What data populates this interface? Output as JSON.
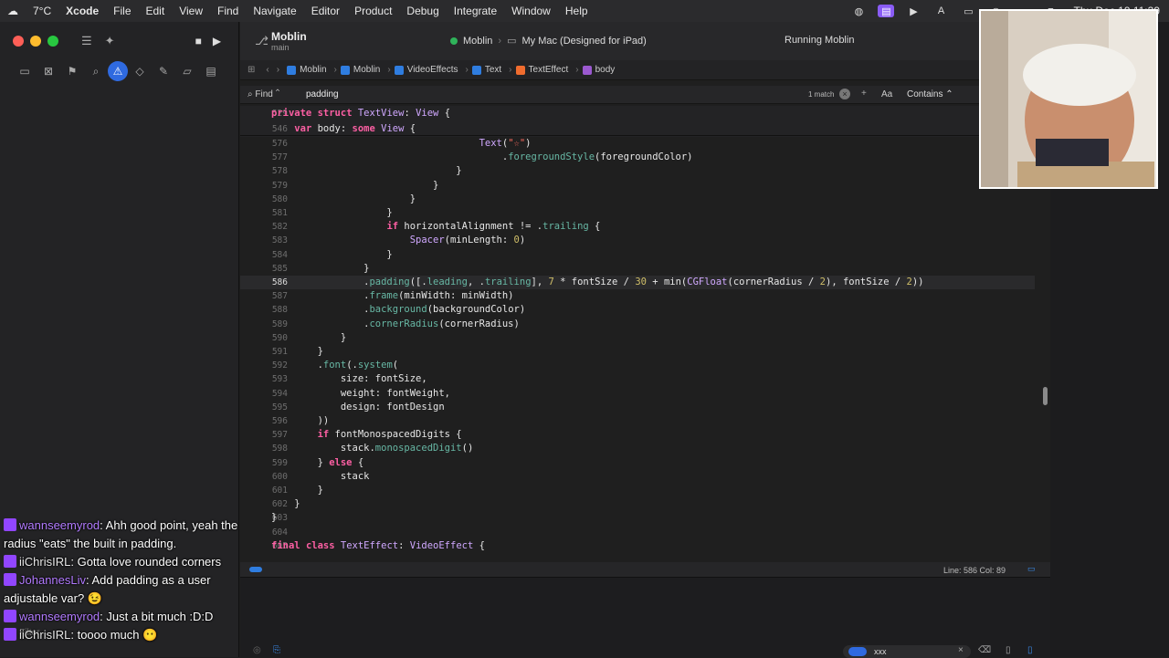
{
  "menubar": {
    "app": "Xcode",
    "items": [
      "File",
      "Edit",
      "View",
      "Find",
      "Navigate",
      "Editor",
      "Product",
      "Debug",
      "Integrate",
      "Window",
      "Help"
    ],
    "clock": "Thu Dec 19 11:39",
    "weather": "7°C"
  },
  "toolbar": {
    "project": "Moblin",
    "branch": "main",
    "scheme": "Moblin",
    "destination": "My Mac (Designed for iPad)",
    "status": "Running Moblin"
  },
  "jumpbar": {
    "crumbs": [
      {
        "label": "Moblin",
        "color": "#2f7de0"
      },
      {
        "label": "Moblin",
        "color": "#2f7de0"
      },
      {
        "label": "VideoEffects",
        "color": "#2f7de0"
      },
      {
        "label": "Text",
        "color": "#2f7de0"
      },
      {
        "label": "TextEffect",
        "color": "#f06c2e"
      },
      {
        "label": "body",
        "color": "#9b59d0"
      }
    ]
  },
  "find": {
    "label": "Find",
    "query": "padding",
    "match_count": "1 match",
    "case_label": "Aa",
    "mode": "Contains"
  },
  "code": {
    "sticky": [
      {
        "n": "529",
        "t": "private struct TextView: View {"
      },
      {
        "n": "546",
        "t": "    var body: some View {"
      }
    ],
    "lines": [
      {
        "n": "576",
        "t": "                                    Text(\"☆\")"
      },
      {
        "n": "577",
        "t": "                                        .foregroundStyle(foregroundColor)"
      },
      {
        "n": "578",
        "t": "                                }"
      },
      {
        "n": "579",
        "t": "                            }"
      },
      {
        "n": "580",
        "t": "                        }"
      },
      {
        "n": "581",
        "t": "                    }"
      },
      {
        "n": "582",
        "t": "                    if horizontalAlignment != .trailing {"
      },
      {
        "n": "583",
        "t": "                        Spacer(minLength: 0)"
      },
      {
        "n": "584",
        "t": "                    }"
      },
      {
        "n": "585",
        "t": "                }"
      },
      {
        "n": "586",
        "t": "                .padding([.leading, .trailing], 7 * fontSize / 30 + min(CGFloat(cornerRadius / 2), fontSize / 2))"
      },
      {
        "n": "587",
        "t": "                .frame(minWidth: minWidth)"
      },
      {
        "n": "588",
        "t": "                .background(backgroundColor)"
      },
      {
        "n": "589",
        "t": "                .cornerRadius(cornerRadius)"
      },
      {
        "n": "590",
        "t": "            }"
      },
      {
        "n": "591",
        "t": "        }"
      },
      {
        "n": "592",
        "t": "        .font(.system("
      },
      {
        "n": "593",
        "t": "            size: fontSize,"
      },
      {
        "n": "594",
        "t": "            weight: fontWeight,"
      },
      {
        "n": "595",
        "t": "            design: fontDesign"
      },
      {
        "n": "596",
        "t": "        ))"
      },
      {
        "n": "597",
        "t": "        if fontMonospacedDigits {"
      },
      {
        "n": "598",
        "t": "            stack.monospacedDigit()"
      },
      {
        "n": "599",
        "t": "        } else {"
      },
      {
        "n": "600",
        "t": "            stack"
      },
      {
        "n": "601",
        "t": "        }"
      },
      {
        "n": "602",
        "t": "    }"
      },
      {
        "n": "603",
        "t": "}"
      },
      {
        "n": "604",
        "t": ""
      },
      {
        "n": "605",
        "t": "final class TextEffect: VideoEffect {"
      }
    ],
    "current_line": "586"
  },
  "debug": {
    "position": "Line: 586  Col: 89",
    "filter_value": "xxx"
  },
  "navigator": {
    "filter_placeholder": "Filter"
  },
  "chat": [
    {
      "user": "wannseemyrod",
      "text": "Ahh good point, yeah the radius \"eats\" the built in padding."
    },
    {
      "user": "iiChrisIRL",
      "text": "Gotta love rounded corners"
    },
    {
      "user": "JohannesLiv",
      "text": "Add padding as a user adjustable var? 😉"
    },
    {
      "user": "wannseemyrod",
      "text": "Just a bit much :D:D"
    },
    {
      "user": "iiChrisIRL",
      "text": "toooo much 😶"
    }
  ]
}
